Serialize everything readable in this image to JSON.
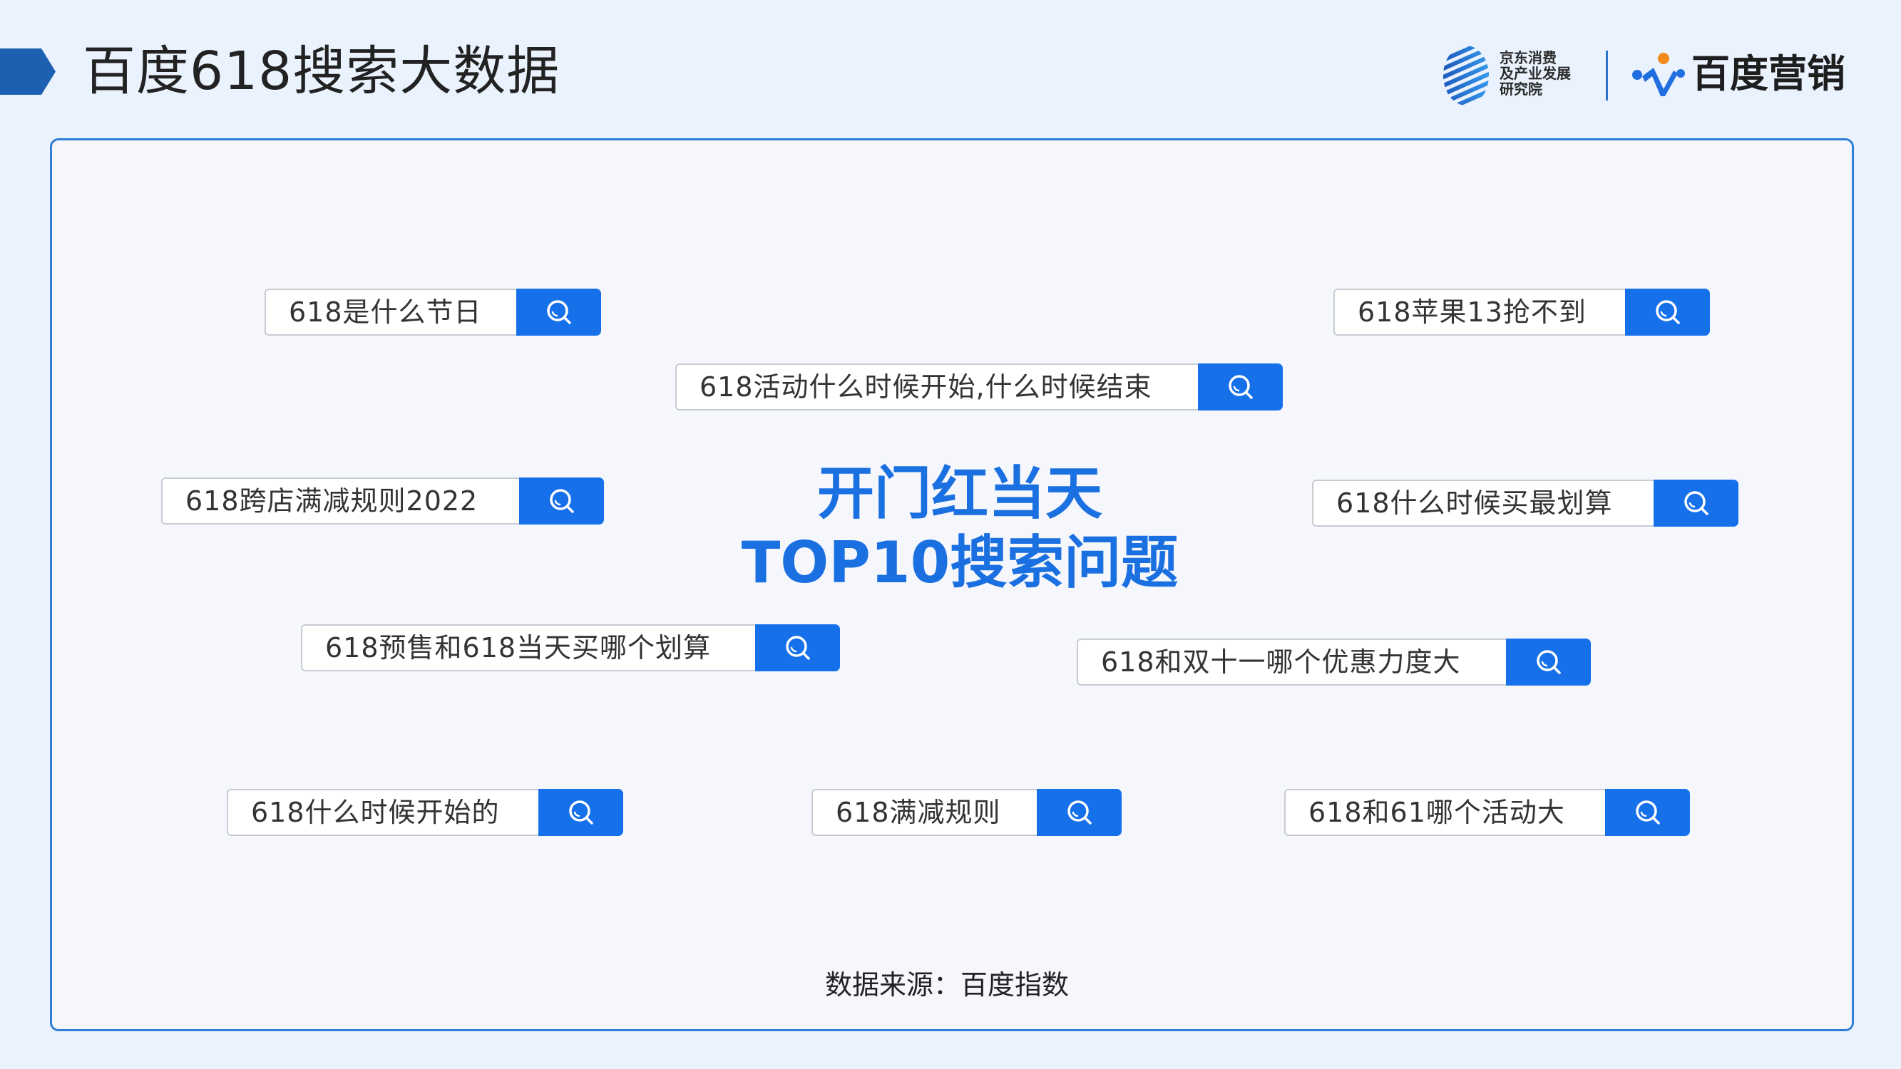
{
  "header": {
    "title": "百度618搜索大数据",
    "jd_logo": {
      "icon": "jd-stripes-logo-icon",
      "lines": [
        "京东消费",
        "及产业发展",
        "研究院"
      ]
    },
    "baidu_logo": {
      "icon": "baidu-marketing-logo-icon",
      "text": "百度营销"
    }
  },
  "main": {
    "heading_line1": "开门红当天",
    "heading_line2": "TOP10搜索问题",
    "queries": [
      "618是什么节日",
      "618苹果13抢不到",
      "618活动什么时候开始,什么时候结束",
      "618跨店满减规则2022",
      "618什么时候买最划算",
      "618预售和618当天买哪个划算",
      "618和双十一哪个优惠力度大",
      "618什么时候开始的",
      "618满减规则",
      "618和61哪个活动大"
    ],
    "source": "数据来源：百度指数"
  },
  "icons": {
    "title_marker": "arrow-marker-icon",
    "search": "search-icon"
  },
  "colors": {
    "page_background": "#e9f2fd",
    "card_background": "#f5f7fd",
    "card_border": "#2f7fd6",
    "accent_heading": "#1a70e0",
    "search_button": "#1570ea",
    "title_marker": "#1d60b2"
  }
}
